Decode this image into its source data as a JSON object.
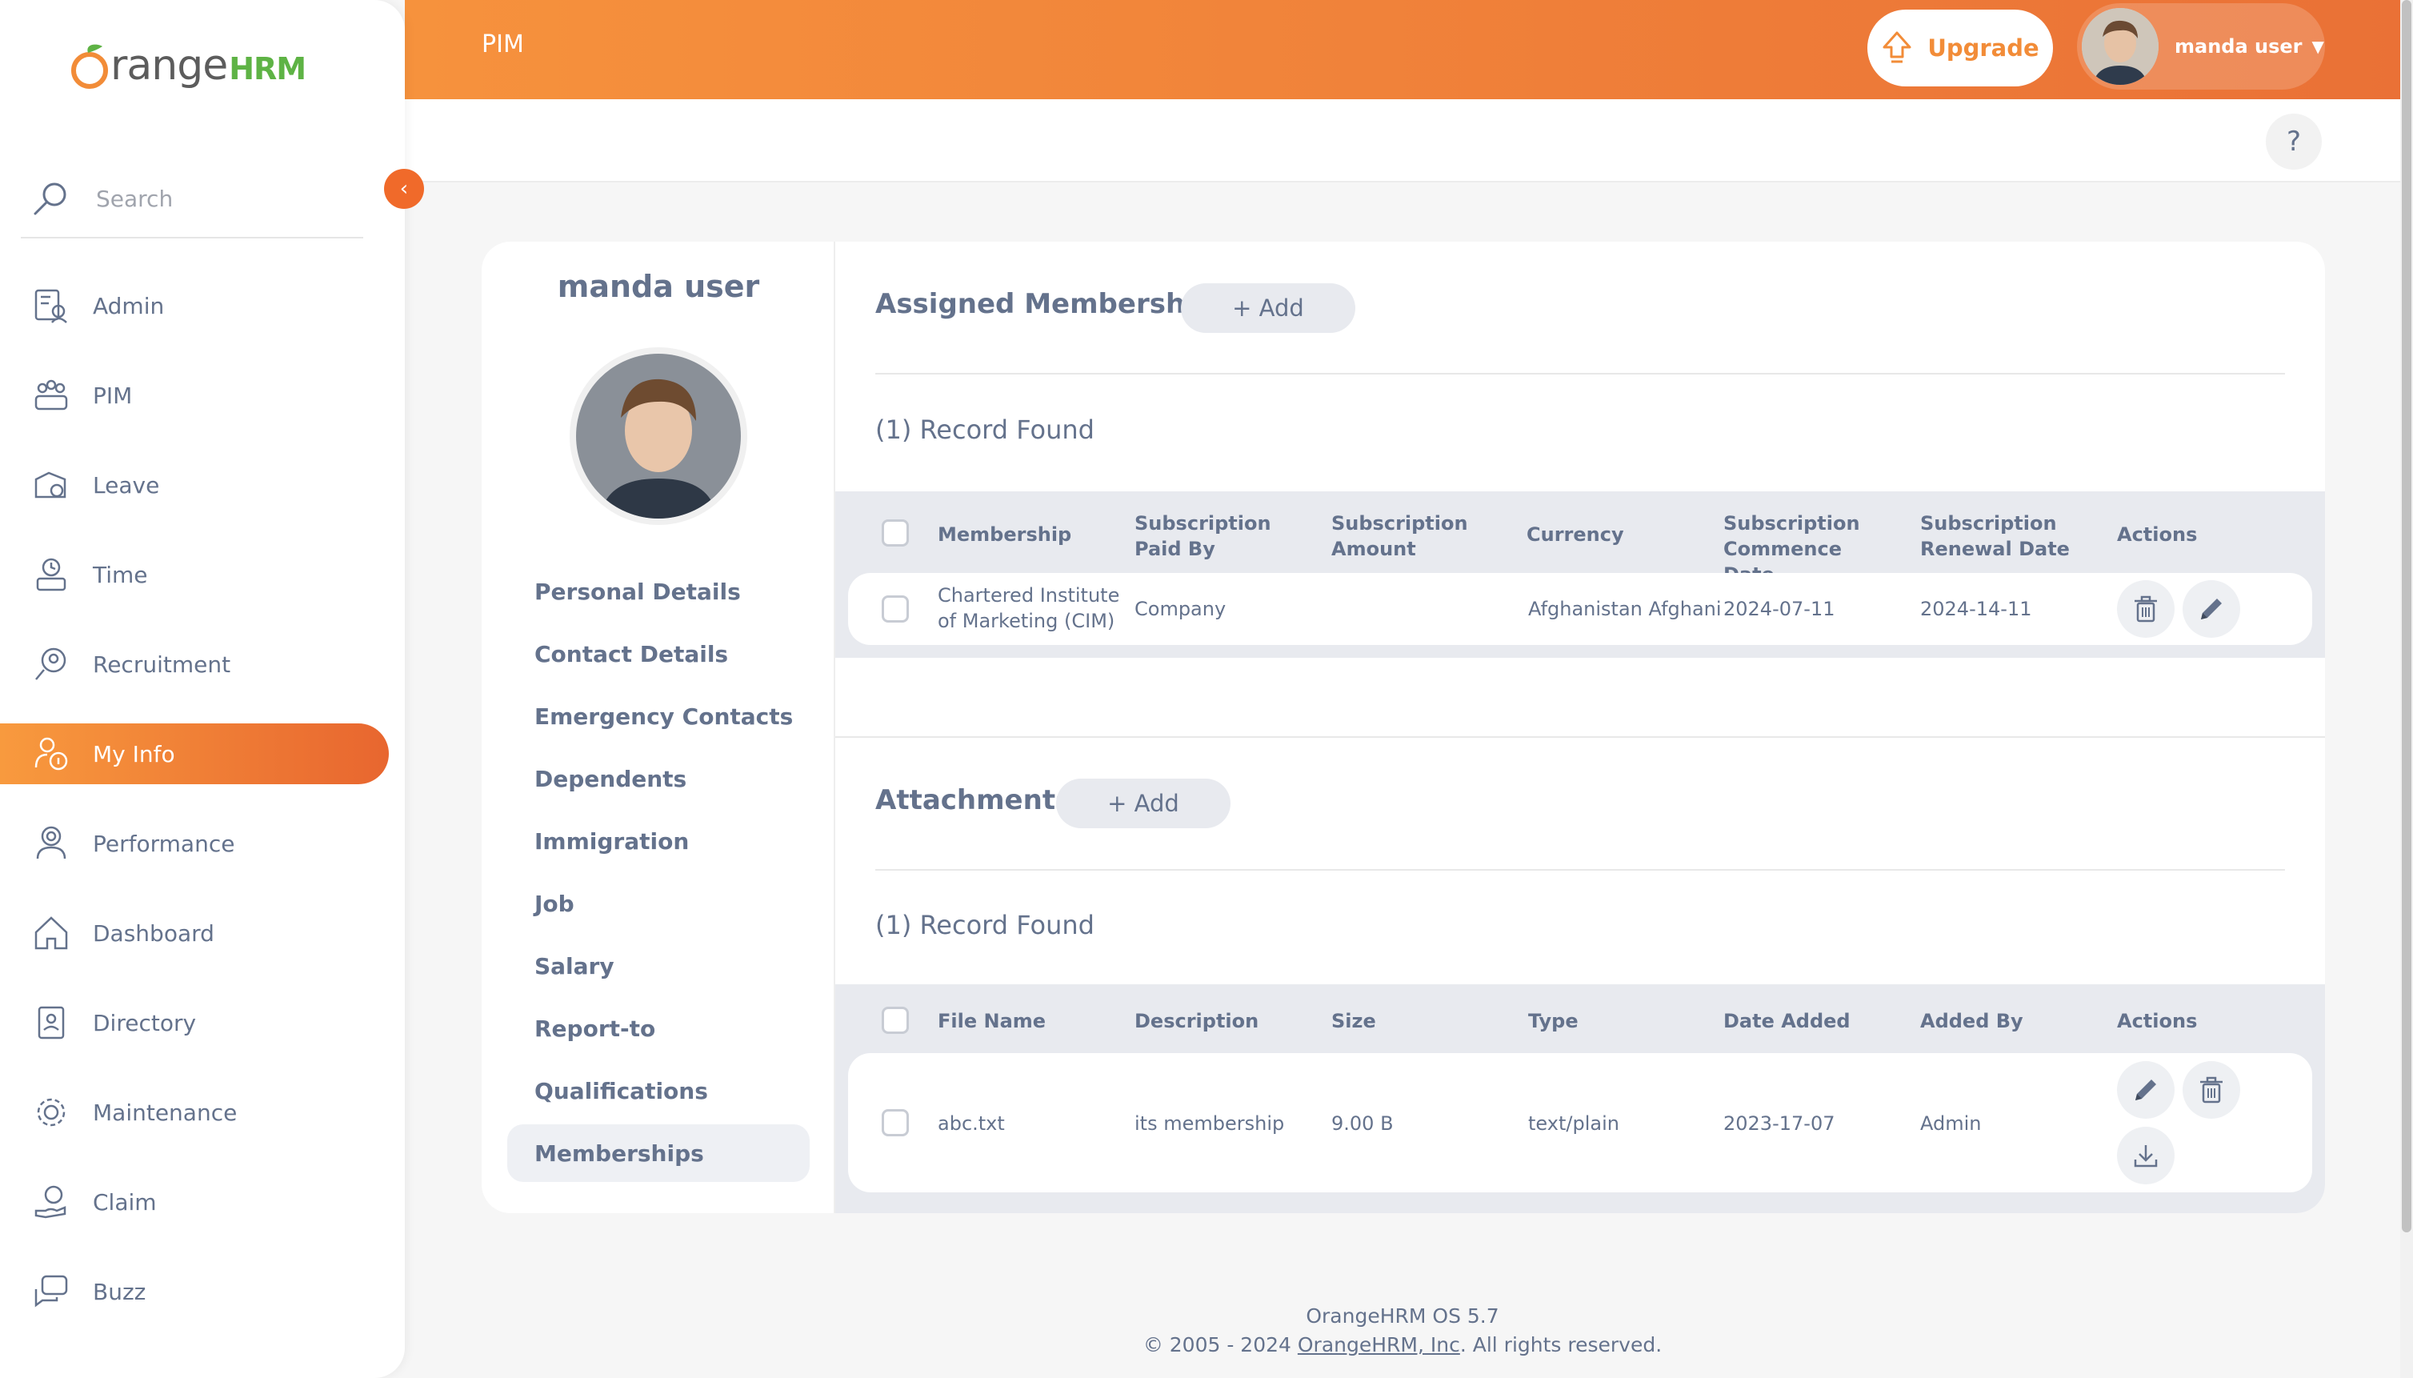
{
  "app": {
    "logo_orange": "Orange",
    "logo_hrm": "HRM"
  },
  "sidebar": {
    "search_placeholder": "Search",
    "items": [
      {
        "label": "Admin",
        "icon": "admin-icon"
      },
      {
        "label": "PIM",
        "icon": "pim-icon"
      },
      {
        "label": "Leave",
        "icon": "leave-icon"
      },
      {
        "label": "Time",
        "icon": "time-icon"
      },
      {
        "label": "Recruitment",
        "icon": "recruitment-icon"
      },
      {
        "label": "My Info",
        "icon": "my-info-icon",
        "active": true
      },
      {
        "label": "Performance",
        "icon": "performance-icon"
      },
      {
        "label": "Dashboard",
        "icon": "dashboard-icon"
      },
      {
        "label": "Directory",
        "icon": "directory-icon"
      },
      {
        "label": "Maintenance",
        "icon": "maintenance-icon"
      },
      {
        "label": "Claim",
        "icon": "claim-icon"
      },
      {
        "label": "Buzz",
        "icon": "buzz-icon"
      }
    ]
  },
  "topbar": {
    "title": "PIM",
    "upgrade_label": "Upgrade",
    "user_name": "manda user"
  },
  "help": {
    "label": "?"
  },
  "profile": {
    "name": "manda user",
    "tabs": [
      "Personal Details",
      "Contact Details",
      "Emergency Contacts",
      "Dependents",
      "Immigration",
      "Job",
      "Salary",
      "Report-to",
      "Qualifications",
      "Memberships"
    ],
    "active_tab": "Memberships"
  },
  "memberships": {
    "title": "Assigned Memberships",
    "add_label": "+  Add",
    "records_label": "(1) Record Found",
    "columns": [
      "Membership",
      "Subscription Paid By",
      "Subscription Amount",
      "Currency",
      "Subscription Commence Date",
      "Subscription Renewal Date",
      "Actions"
    ],
    "rows": [
      {
        "membership": "Chartered Institute of Marketing (CIM)",
        "paid_by": "Company",
        "amount": "",
        "currency": "Afghanistan Afghani",
        "commence": "2024-07-11",
        "renewal": "2024-14-11"
      }
    ]
  },
  "attachments": {
    "title": "Attachments",
    "add_label": "+  Add",
    "records_label": "(1) Record Found",
    "columns": [
      "File Name",
      "Description",
      "Size",
      "Type",
      "Date Added",
      "Added By",
      "Actions"
    ],
    "rows": [
      {
        "file_name": "abc.txt",
        "description": "its membership",
        "size": "9.00 B",
        "type": "text/plain",
        "date_added": "2023-17-07",
        "added_by": "Admin"
      }
    ]
  },
  "footer": {
    "version": "OrangeHRM OS 5.7",
    "copyright_prefix": "© 2005 - 2024 ",
    "link": "OrangeHRM, Inc",
    "copyright_suffix": ". All rights reserved."
  },
  "colors": {
    "accent": "#f28c38",
    "accent_dark": "#e8662f",
    "text": "#64728c",
    "brand_green": "#5eb345"
  }
}
